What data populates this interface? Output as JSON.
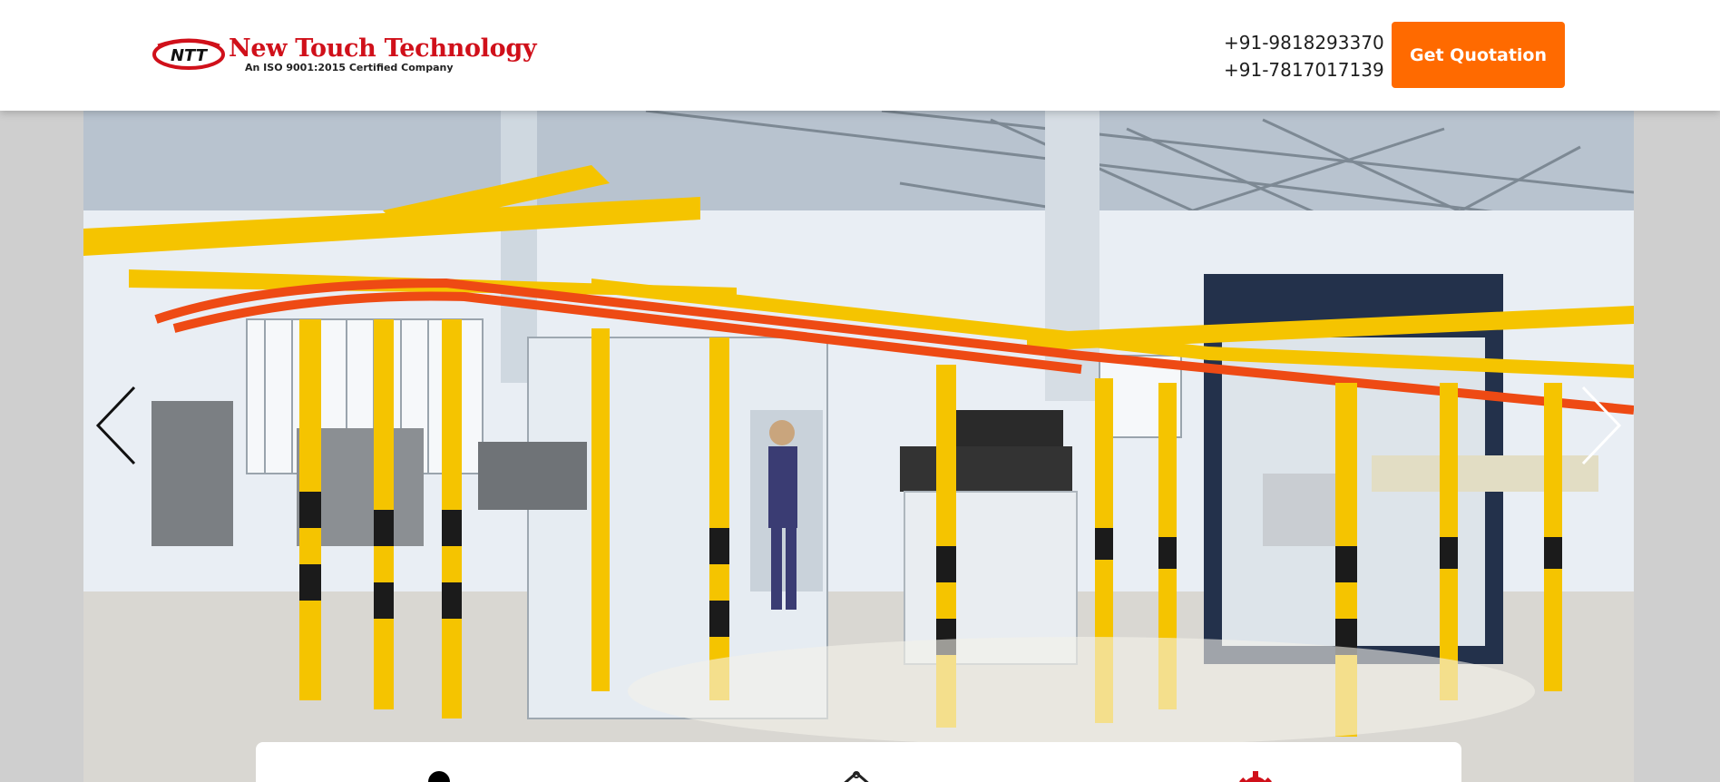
{
  "header": {
    "logo": {
      "badge_text": "NTT",
      "title": "New Touch Technology",
      "subtitle": "An ISO 9001:2015 Certified Company"
    },
    "phones": [
      "+91-9818293370",
      "+91-7817017139"
    ],
    "cta_label": "Get Quotation"
  },
  "slider": {
    "image_alt": "Powder coating plant with overhead conveyor",
    "prev_icon": "chevron-left-icon",
    "next_icon": "chevron-right-icon"
  },
  "features": {
    "icons": [
      "person-icon",
      "hanger-icon",
      "gear-icon"
    ]
  },
  "colors": {
    "brand_red": "#d0101a",
    "accent_orange": "#ff6a00",
    "conveyor_yellow": "#f5c400",
    "conveyor_red": "#ee4a14"
  }
}
